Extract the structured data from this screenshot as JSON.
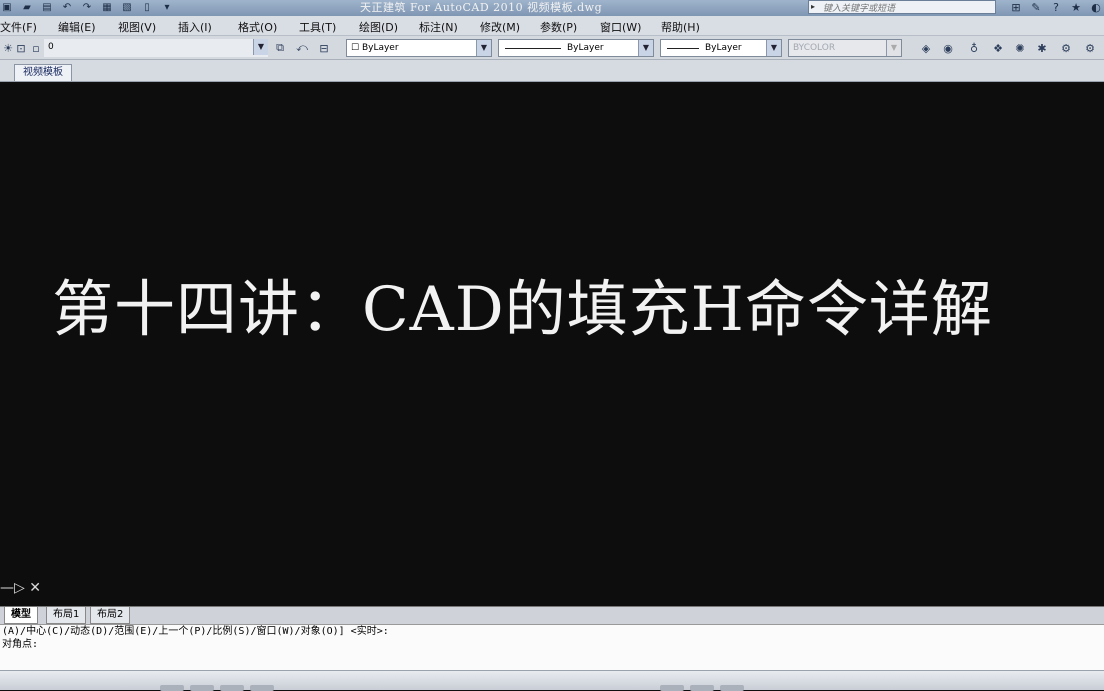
{
  "window": {
    "title": "天正建筑 For AutoCAD 2010  视频模板.dwg"
  },
  "quick_access": {
    "icons": [
      "app-menu-icon",
      "open-icon",
      "save-icon",
      "undo-icon",
      "redo-icon",
      "print-icon",
      "publish-icon",
      "plot-icon",
      "dropdown-icon"
    ]
  },
  "search": {
    "placeholder": "键入关键字或短语"
  },
  "menu": {
    "items": [
      "文件(F)",
      "编辑(E)",
      "视图(V)",
      "插入(I)",
      "格式(O)",
      "工具(T)",
      "绘图(D)",
      "标注(N)",
      "修改(M)",
      "参数(P)",
      "窗口(W)",
      "帮助(H)"
    ]
  },
  "toolbar": {
    "layer_value": "0",
    "color_value": "ByLayer",
    "linetype_value": "ByLayer",
    "lineweight_value": "ByLayer",
    "plotstyle_value": "BYCOLOR"
  },
  "file_tab": {
    "label": "视频模板"
  },
  "drawing": {
    "headline": "第十四讲：CAD的填充H命令详解"
  },
  "layout_tabs": [
    "模型",
    "布局1",
    "布局2"
  ],
  "command_line": {
    "line1": "(A)/中心(C)/动态(D)/范围(E)/上一个(P)/比例(S)/窗口(W)/对象(O)] <实时>:",
    "line2": "对角点:"
  },
  "colors": {
    "canvas": "#0d0d0d",
    "titlebar": "#8aa0bc",
    "menubar": "#d9dde4"
  }
}
